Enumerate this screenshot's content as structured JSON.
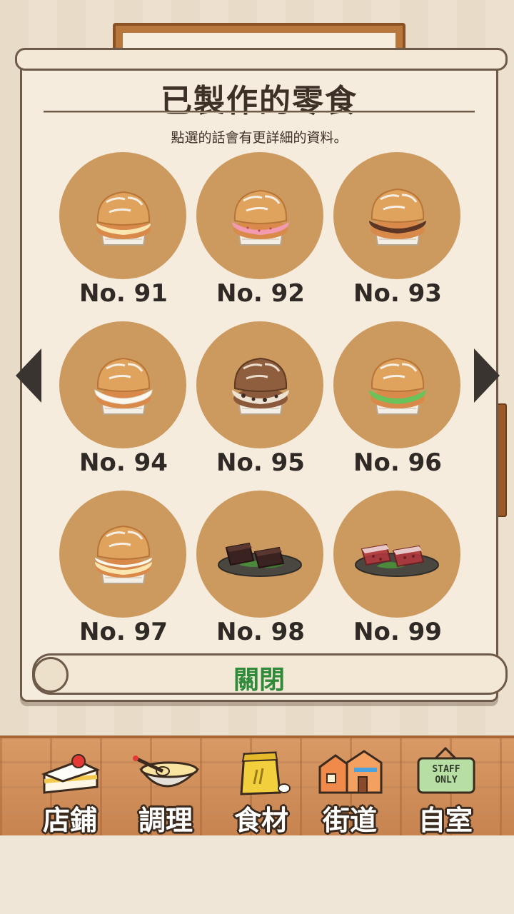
{
  "dialog": {
    "title": "已製作的零食",
    "hint": "點選的話會有更詳細的資料。",
    "close_label": "關閉"
  },
  "items": [
    {
      "no": "No. 91",
      "icon": "cream-puff-custard-icon"
    },
    {
      "no": "No. 92",
      "icon": "cream-puff-strawberry-icon"
    },
    {
      "no": "No. 93",
      "icon": "cream-puff-chocolate-icon"
    },
    {
      "no": "No. 94",
      "icon": "cream-puff-whipped-cream-icon"
    },
    {
      "no": "No. 95",
      "icon": "cream-puff-cookies-cream-icon"
    },
    {
      "no": "No. 96",
      "icon": "cream-puff-matcha-icon"
    },
    {
      "no": "No. 97",
      "icon": "cream-puff-double-cream-icon"
    },
    {
      "no": "No. 98",
      "icon": "chocolate-yokan-icon"
    },
    {
      "no": "No. 99",
      "icon": "red-bean-jelly-icon"
    }
  ],
  "navigation": {
    "prev_icon": "triangle-left-icon",
    "next_icon": "triangle-right-icon"
  },
  "menu": [
    {
      "label": "店鋪",
      "icon": "strawberry-cake-icon"
    },
    {
      "label": "調理",
      "icon": "mixing-bowl-whisk-icon"
    },
    {
      "label": "食材",
      "icon": "flour-sack-icon"
    },
    {
      "label": "街道",
      "icon": "town-houses-icon"
    },
    {
      "label": "自室",
      "icon": "staff-only-sign-icon",
      "sign_text": "STAFF ONLY"
    }
  ],
  "colors": {
    "circle": "#cc9a5e",
    "close_text": "#2f8a3a",
    "panel": "#f6ecde"
  }
}
